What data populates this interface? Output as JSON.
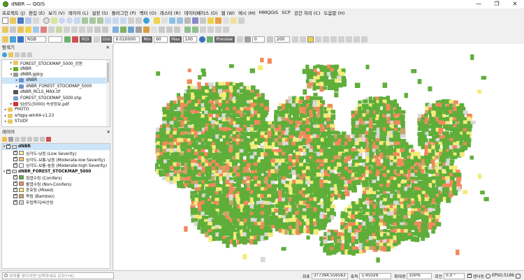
{
  "window": {
    "title": "dNBR — QGIS",
    "controls": [
      "—",
      "❐",
      "✕"
    ]
  },
  "menu": [
    "프로젝트 (J)",
    "편집 (E)",
    "보기 (V)",
    "레이어 (L)",
    "설정 (S)",
    "플러그인 (P)",
    "벡터 (O)",
    "래스터 (R)",
    "데이터베이스 (D)",
    "웹 (W)",
    "메시 (M)",
    "MMQGIS",
    "SCP",
    "공간 처리 (C)",
    "도움말 (H)"
  ],
  "raster_toolbar": {
    "band": "RGB",
    "roi_label": "ROI",
    "dist_label": "Dist",
    "dist_value": "0.010000",
    "min_label": "Min",
    "min_value": "60",
    "max_label": "Max",
    "max_value": "100",
    "preview_label": "Preview",
    "field1": "0",
    "field2": "200"
  },
  "browser": {
    "title": "탐색기",
    "close": "✕",
    "items": [
      {
        "label": "FOREST_STOCKMAP_5000_강원",
        "indent": 1,
        "arrow": "▸",
        "color": "#e8c860"
      },
      {
        "label": "dNBR",
        "indent": 1,
        "arrow": "▸",
        "color": "#6aab2a"
      },
      {
        "label": "dNBR.gpkg",
        "indent": 1,
        "arrow": "▾",
        "color": "#999999"
      },
      {
        "label": "dNBR",
        "indent": 2,
        "arrow": "▸",
        "color": "#6a8fc8",
        "selected": true
      },
      {
        "label": "dNBR_FOREST_STOCKMAP_5000",
        "indent": 2,
        "arrow": "▸",
        "color": "#6a8fc8"
      },
      {
        "label": "dNBR_RCLS_MAX.tif",
        "indent": 1,
        "arrow": "",
        "color": "#555555"
      },
      {
        "label": "FOREST_STOCKMAP_5000.shp",
        "indent": 1,
        "arrow": "",
        "color": "#7aa0d0"
      },
      {
        "label": "임상도(5000) 속성정보.pdf",
        "indent": 1,
        "arrow": "▸",
        "color": "#cc3333"
      },
      {
        "label": "PHOTO",
        "indent": 0,
        "arrow": "▸",
        "color": "#e8c860"
      },
      {
        "label": "srtqpy-win64-v1.23",
        "indent": 0,
        "arrow": "▸",
        "color": "#e8c860"
      },
      {
        "label": "STUDY",
        "indent": 0,
        "arrow": "▸",
        "color": "#e8c860"
      }
    ]
  },
  "layers": {
    "title": "레이어",
    "close": "✕",
    "group1": {
      "label": "dNBR",
      "classes": [
        {
          "label": "심각도-낮음 (Low Severity)",
          "color": "#f4f2a8"
        },
        {
          "label": "심각도-보통-낮음 (Moderate-low Severity)",
          "color": "#f6c26a"
        },
        {
          "label": "심각도-보통-높음 (Moderate-high Severity)",
          "color": "#ffffff"
        }
      ]
    },
    "group2": {
      "label": "dNBR_FOREST_STOCKMAP_5000",
      "classes": [
        {
          "label": "침엽수림 (Conifers)",
          "color": "#5fae3a"
        },
        {
          "label": "활엽수림 (Non-Conifers)",
          "color": "#f08a5a"
        },
        {
          "label": "혼효림 (Mixed)",
          "color": "#f5eb7a"
        },
        {
          "label": "죽림 (Bamboo)",
          "color": "#c9a66b"
        },
        {
          "label": "무립목지/비산림",
          "color": "#d9d9d9"
        }
      ]
    }
  },
  "status": {
    "locator_placeholder": "위치를 찾으려면 입력하세요 (Ctrl+K)",
    "coord_label": "좌표",
    "coord_value": "377394,556563",
    "scale_label": "축척",
    "scale_value": "1:45029",
    "magnifier_label": "확대경",
    "magnifier_value": "100%",
    "rotation_label": "회전",
    "rotation_value": "0.0 °",
    "render_label": "렌더링",
    "crs": "EPSG:5186"
  },
  "map_colors": {
    "conifers": "#5fae3a",
    "non_conifers": "#f08a5a",
    "mixed": "#f5eb7a",
    "bamboo": "#c9a66b",
    "nonforest": "#d9d9d9"
  }
}
